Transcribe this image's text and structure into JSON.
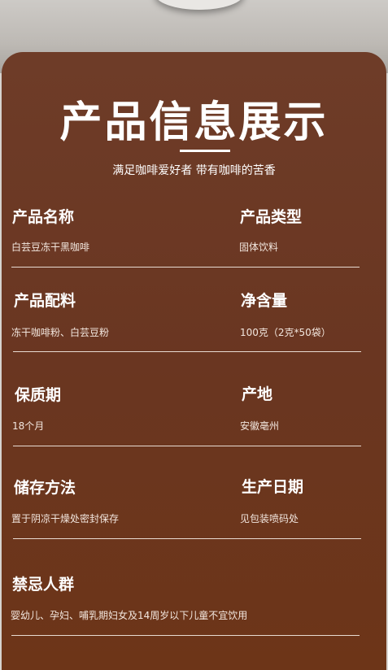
{
  "title": "产品信息展示",
  "subtitle": "满足咖啡爱好者 带有咖啡的苦香",
  "rows": [
    {
      "left": {
        "label": "产品名称",
        "value": "白芸豆冻干黑咖啡"
      },
      "right": {
        "label": "产品类型",
        "value": "固体饮料"
      }
    },
    {
      "left": {
        "label": "产品配料",
        "value": "冻干咖啡粉、白芸豆粉"
      },
      "right": {
        "label": "净含量",
        "value": "100克（2克*50袋）"
      }
    },
    {
      "left": {
        "label": "保质期",
        "value": "18个月"
      },
      "right": {
        "label": "产地",
        "value": "安徽亳州"
      }
    },
    {
      "left": {
        "label": "储存方法",
        "value": "置于阴凉干燥处密封保存"
      },
      "right": {
        "label": "生产日期",
        "value": "见包装喷码处"
      }
    }
  ],
  "contraindication": {
    "label": "禁忌人群",
    "value": "婴幼儿、孕妇、哺乳期妇女及14周岁以下儿童不宜饮用"
  }
}
